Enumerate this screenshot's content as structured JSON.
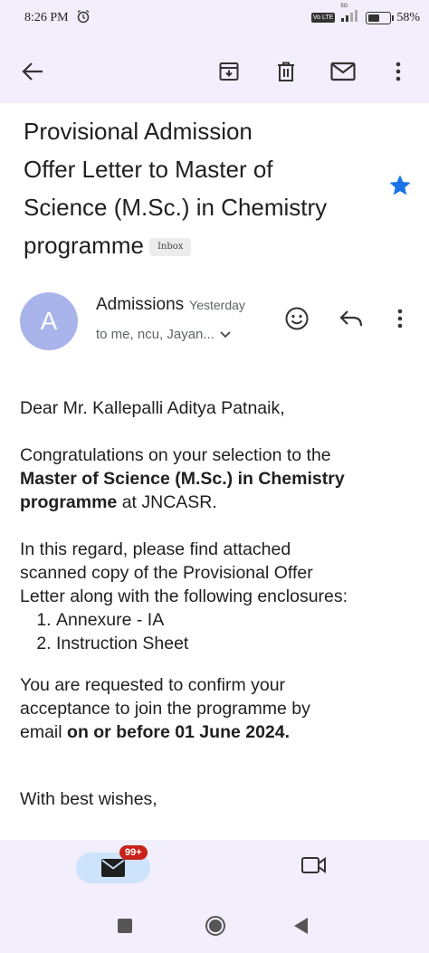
{
  "status_bar": {
    "time": "8:26 PM",
    "network_label": "5G",
    "volte_label": "Vo LTE",
    "battery": "58%",
    "battery_level": 0.58
  },
  "toolbar": {
    "icons": [
      "back-arrow-icon",
      "archive-icon",
      "delete-icon",
      "mark-unread-icon",
      "more-icon"
    ]
  },
  "email": {
    "subject_lines": [
      "Provisional Admission",
      "Offer Letter to Master of",
      "Science (M.Sc.) in Chemistry",
      "programme"
    ],
    "label_chip": "Inbox",
    "starred": true,
    "star_color": "#1a73e8",
    "avatar_letter": "A",
    "avatar_color": "#a9b4ea",
    "sender": "Admissions",
    "received": "Yesterday",
    "recipients": "to me, ncu, Jayan...",
    "body": {
      "greeting": "Dear Mr. Kallepalli Aditya Patnaik,",
      "p1_a": "Congratulations on your selection to the",
      "p1_bold": "Master of Science (M.Sc.) in Chemistry programme",
      "p1_b": " at JNCASR.",
      "p2_line1": "In this regard, please find attached",
      "p2_line2": "scanned copy of the Provisional Offer",
      "p2_line3": "Letter along with the following enclosures:",
      "enclosures": [
        "Annexure - IA",
        "Instruction Sheet"
      ],
      "p3_line1": "You are requested to confirm your",
      "p3_line2": "acceptance to join the programme by",
      "p3_prefix": "email ",
      "p3_bold": "on or before  01 June 2024.",
      "closing": "With best wishes,"
    }
  },
  "bottom_nav": {
    "mail_badge": "99+",
    "mail_active_color": "#cde3fc",
    "badge_color": "#c8221b"
  }
}
